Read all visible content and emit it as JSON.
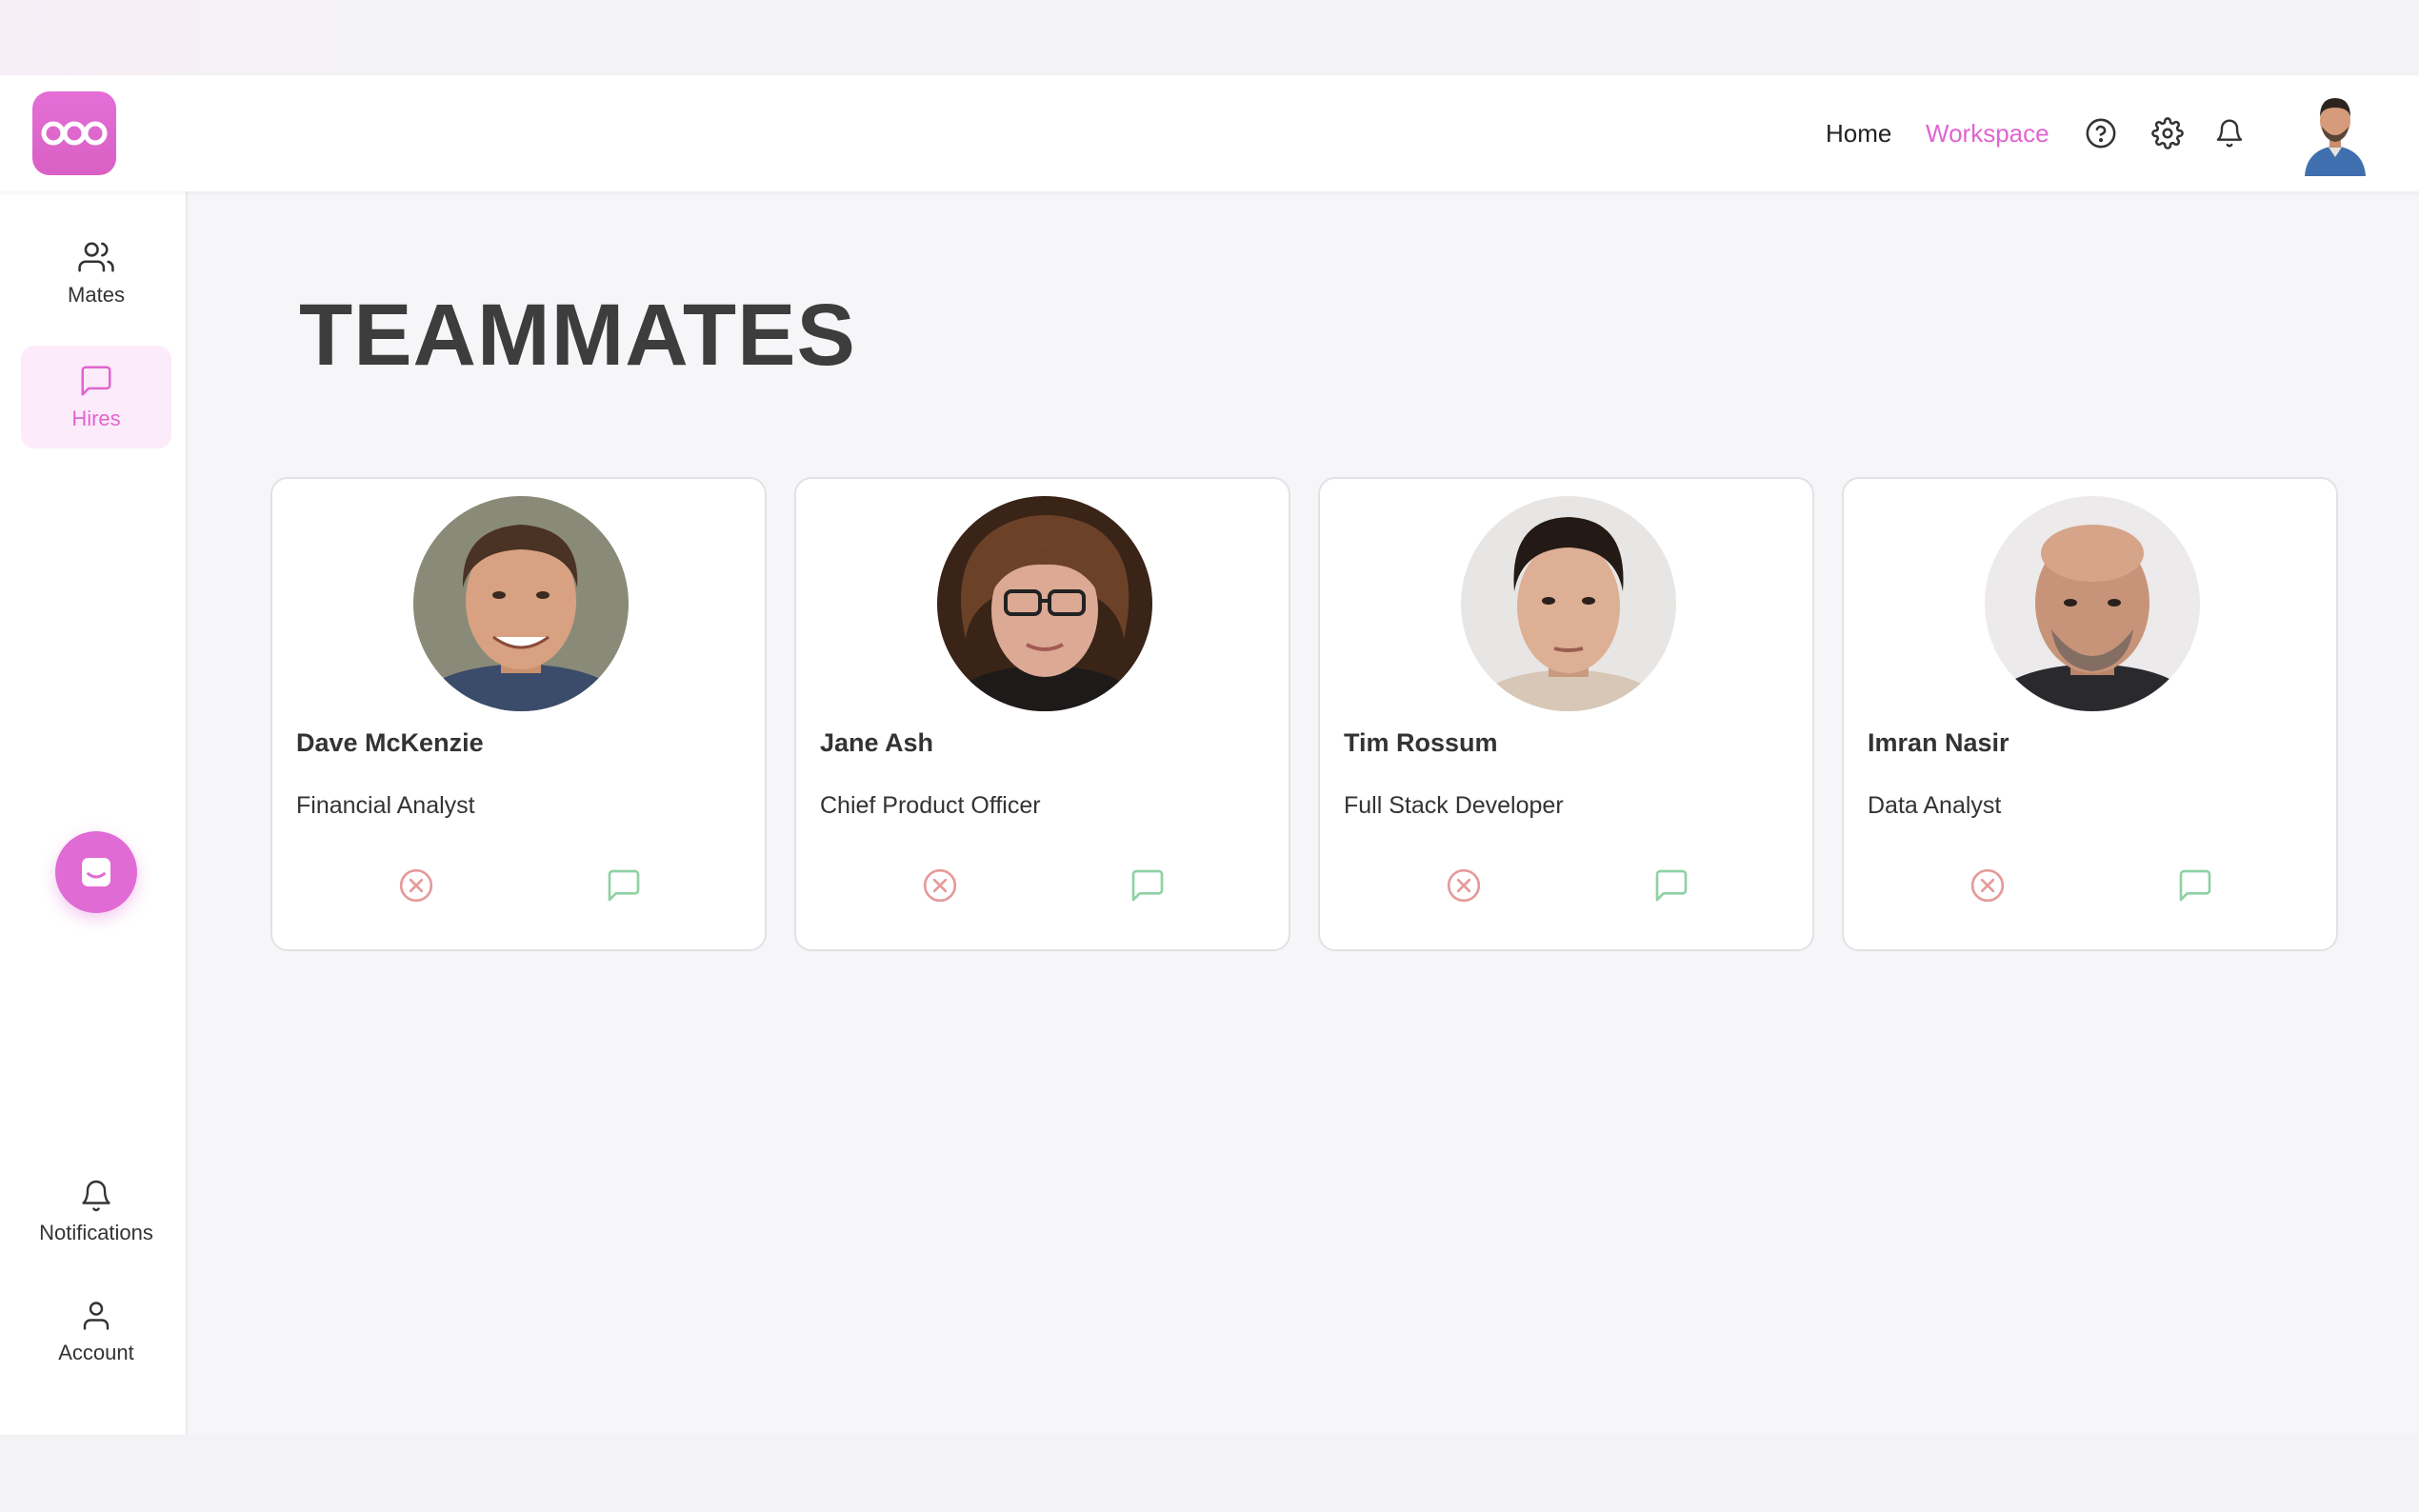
{
  "header": {
    "logo_text": "OOO",
    "nav": {
      "home": "Home",
      "workspace": "Workspace"
    },
    "icons": [
      "help-icon",
      "gear-icon",
      "bell-icon"
    ],
    "accent_color": "#e065cf"
  },
  "sidebar": {
    "items": [
      {
        "label": "Mates",
        "icon": "users-icon",
        "active": false
      },
      {
        "label": "Hires",
        "icon": "message-square-icon",
        "active": true
      },
      {
        "label": "Notifications",
        "icon": "bell-icon",
        "active": false
      },
      {
        "label": "Account",
        "icon": "user-icon",
        "active": false
      }
    ],
    "chat_button_icon": "chat-widget-icon"
  },
  "main": {
    "title": "TEAMMATES",
    "cards": [
      {
        "name": "Dave McKenzie",
        "role": "Financial Analyst"
      },
      {
        "name": "Jane Ash",
        "role": "Chief Product Officer"
      },
      {
        "name": "Tim Rossum",
        "role": "Full Stack Developer"
      },
      {
        "name": "Imran Nasir",
        "role": "Data Analyst"
      }
    ],
    "remove_color": "#e59a9a",
    "message_color": "#8fd1a4"
  }
}
